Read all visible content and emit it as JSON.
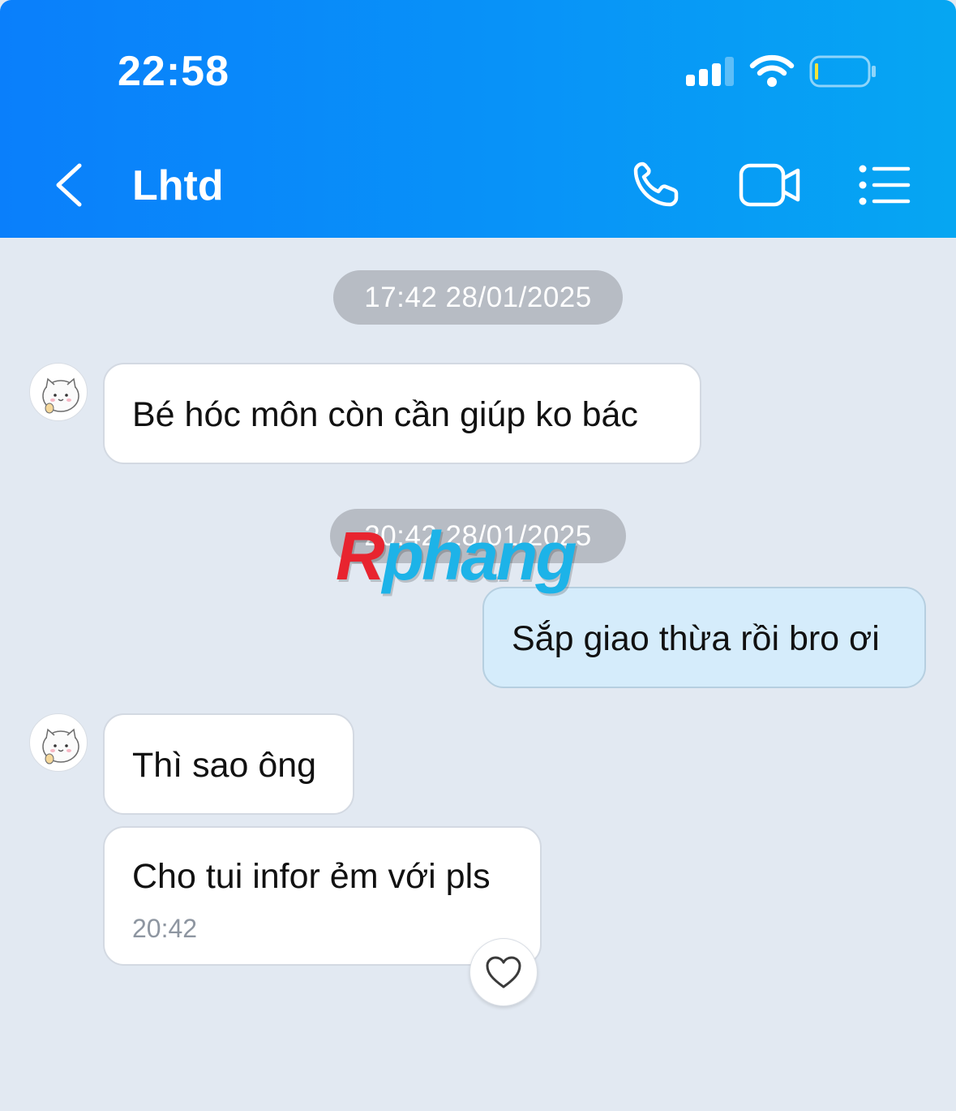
{
  "status_bar": {
    "time": "22:58"
  },
  "header": {
    "title": "Lhtd",
    "icons": [
      "chevron-left-icon",
      "phone-icon",
      "video-camera-icon",
      "list-menu-icon"
    ]
  },
  "messages": {
    "timestamp_1": "17:42 28/01/2025",
    "received_1": "Bé hóc môn còn cần giúp ko bác",
    "timestamp_2": "20:42 28/01/2025",
    "sent_1": "Sắp giao thừa rồi bro ơi",
    "received_2": "Thì sao ông",
    "received_3": "Cho tui infor ẻm với pls",
    "received_3_time": "20:42"
  },
  "watermark": {
    "part_1": "R",
    "part_2": "phang"
  },
  "colors": {
    "header_start": "#0a7ffb",
    "header_end": "#06a6f2",
    "background": "#e2e9f2",
    "sent_bubble": "#d5ecfb",
    "watermark_red": "#e8242f",
    "watermark_blue": "#1db3e8"
  }
}
